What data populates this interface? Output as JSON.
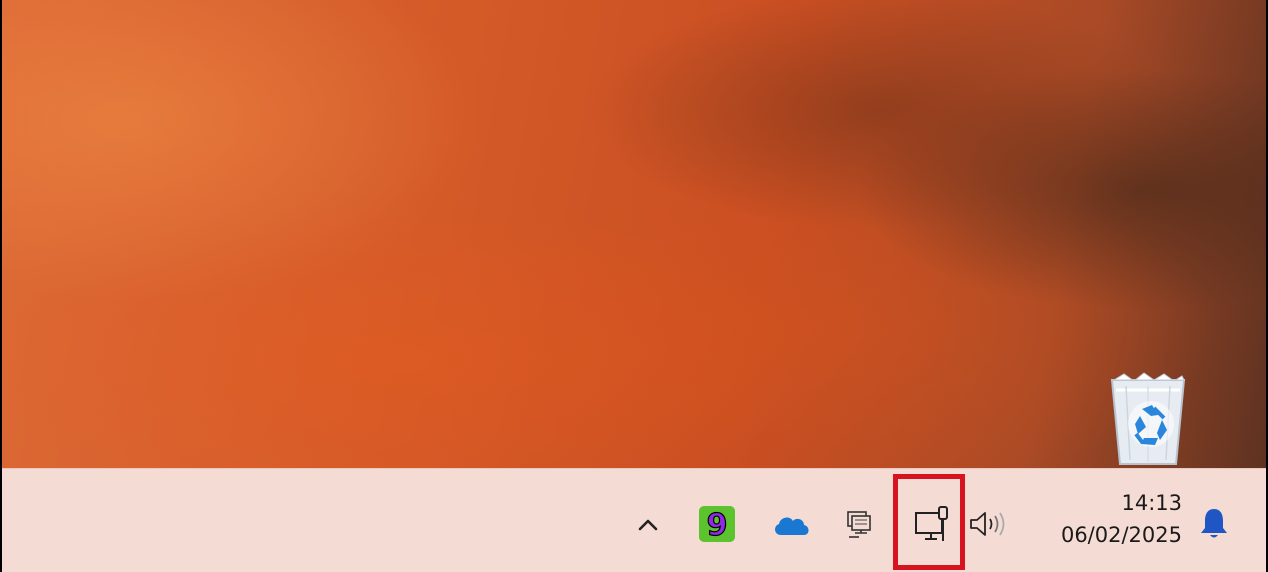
{
  "desktop": {
    "icons": [
      {
        "name": "recycle-bin-icon"
      }
    ]
  },
  "taskbar": {
    "tray": {
      "icons": [
        "chevron-up-icon",
        "app-9-icon",
        "onedrive-cloud-icon",
        "network-pc-icon",
        "lan-network-icon",
        "speaker-volume-icon",
        "notification-bell-icon"
      ],
      "app9_glyph": "9",
      "colors": {
        "onedrive": "#1a78d2",
        "bell": "#1f56c4",
        "highlight": "#d7131f",
        "app9_bg": "#5cc22e",
        "app9_glyph": "#8e2be2"
      }
    },
    "clock": {
      "time": "14:13",
      "date": "06/02/2025"
    }
  }
}
